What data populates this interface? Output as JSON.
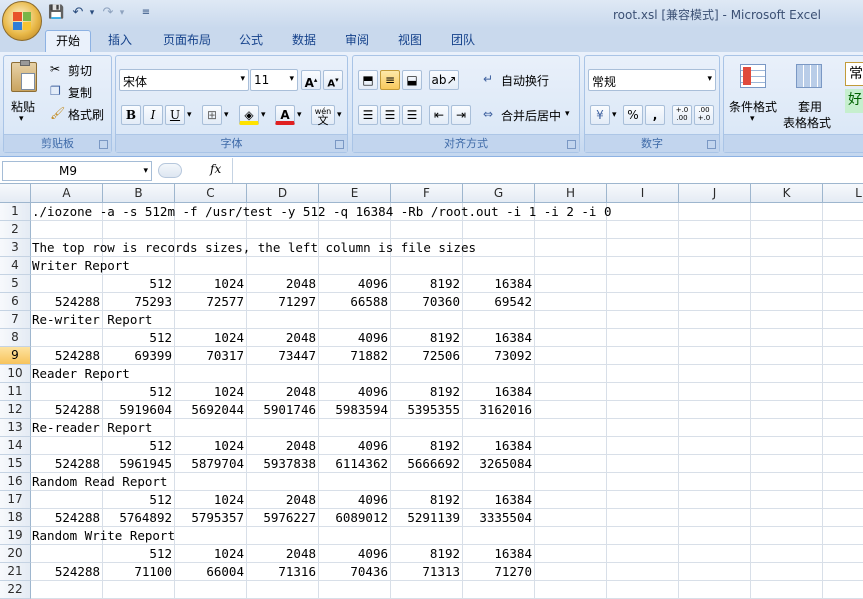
{
  "window": {
    "title": "root.xsl  [兼容模式] - Microsoft Excel"
  },
  "quick_access": {
    "save_icon": "save-icon",
    "undo_icon": "undo-icon",
    "redo_icon": "redo-icon",
    "customize_icon": "dropdown-icon"
  },
  "tabs": [
    "开始",
    "插入",
    "页面布局",
    "公式",
    "数据",
    "审阅",
    "视图",
    "团队"
  ],
  "ribbon": {
    "clipboard": {
      "title": "剪贴板",
      "paste": "粘贴",
      "cut": "剪切",
      "copy": "复制",
      "format_painter": "格式刷"
    },
    "font": {
      "title": "字体",
      "font_name": "宋体",
      "font_size": "11",
      "bold": "B",
      "italic": "I",
      "underline": "U",
      "grow": "A",
      "shrink": "A",
      "wen": "wén",
      "wen2": "文",
      "font_color": "A"
    },
    "alignment": {
      "title": "对齐方式",
      "wrap_text": "自动换行",
      "merge_center": "合并后居中"
    },
    "number": {
      "title": "数字",
      "format": "常规",
      "percent": "%",
      "comma": ",",
      "inc_dec": "+.0 .00",
      "dec_dec": ".00 +.0"
    },
    "styles": {
      "cond_format": "条件格式",
      "table_format_1": "套用",
      "table_format_2": "表格格式",
      "normal": "常",
      "good": "好"
    }
  },
  "formula_bar": {
    "name_box": "M9",
    "fx": "fx",
    "value": ""
  },
  "columns": [
    "A",
    "B",
    "C",
    "D",
    "E",
    "F",
    "G",
    "H",
    "I",
    "J",
    "K",
    "L"
  ],
  "selected_row": "9",
  "rows": [
    {
      "n": "1",
      "text": "./iozone -a -s 512m -f /usr/test -y 512 -q 16384 -Rb /root.out -i 1 -i 2 -i 0"
    },
    {
      "n": "2",
      "text": ""
    },
    {
      "n": "3",
      "text": "The top row is records sizes, the left column is file sizes"
    },
    {
      "n": "4",
      "text": "Writer Report"
    },
    {
      "n": "5",
      "cells": [
        "",
        "512",
        "1024",
        "2048",
        "4096",
        "8192",
        "16384"
      ]
    },
    {
      "n": "6",
      "cells": [
        "524288",
        "75293",
        "72577",
        "71297",
        "66588",
        "70360",
        "69542"
      ]
    },
    {
      "n": "7",
      "text": "Re-writer Report"
    },
    {
      "n": "8",
      "cells": [
        "",
        "512",
        "1024",
        "2048",
        "4096",
        "8192",
        "16384"
      ]
    },
    {
      "n": "9",
      "cells": [
        "524288",
        "69399",
        "70317",
        "73447",
        "71882",
        "72506",
        "73092"
      ]
    },
    {
      "n": "10",
      "text": "Reader Report"
    },
    {
      "n": "11",
      "cells": [
        "",
        "512",
        "1024",
        "2048",
        "4096",
        "8192",
        "16384"
      ]
    },
    {
      "n": "12",
      "cells": [
        "524288",
        "5919604",
        "5692044",
        "5901746",
        "5983594",
        "5395355",
        "3162016"
      ]
    },
    {
      "n": "13",
      "text": "Re-reader Report"
    },
    {
      "n": "14",
      "cells": [
        "",
        "512",
        "1024",
        "2048",
        "4096",
        "8192",
        "16384"
      ]
    },
    {
      "n": "15",
      "cells": [
        "524288",
        "5961945",
        "5879704",
        "5937838",
        "6114362",
        "5666692",
        "3265084"
      ]
    },
    {
      "n": "16",
      "text": "Random Read Report"
    },
    {
      "n": "17",
      "cells": [
        "",
        "512",
        "1024",
        "2048",
        "4096",
        "8192",
        "16384"
      ]
    },
    {
      "n": "18",
      "cells": [
        "524288",
        "5764892",
        "5795357",
        "5976227",
        "6089012",
        "5291139",
        "3335504"
      ]
    },
    {
      "n": "19",
      "text": "Random Write Report"
    },
    {
      "n": "20",
      "cells": [
        "",
        "512",
        "1024",
        "2048",
        "4096",
        "8192",
        "16384"
      ]
    },
    {
      "n": "21",
      "cells": [
        "524288",
        "71100",
        "66004",
        "71316",
        "70436",
        "71313",
        "71270"
      ]
    },
    {
      "n": "22",
      "text": ""
    }
  ]
}
